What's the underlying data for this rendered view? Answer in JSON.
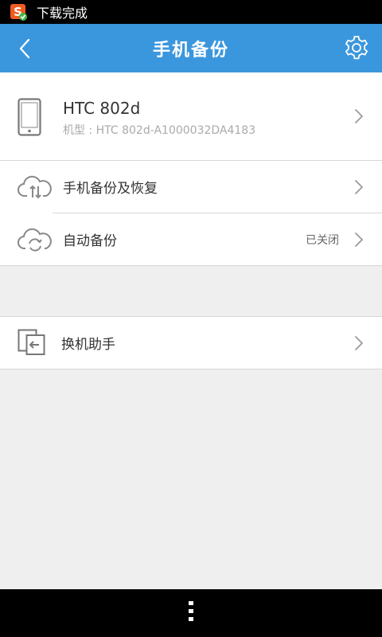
{
  "status_bar": {
    "notification": "下载完成",
    "app_icon": "sougou-s-icon",
    "check_icon": "check-badge-icon"
  },
  "header": {
    "title": "手机备份",
    "back_icon": "chevron-left-icon",
    "settings_icon": "gear-icon",
    "bg_color": "#3b97dd"
  },
  "device": {
    "name": "HTC 802d",
    "model": "机型 : HTC 802d-A1000032DA4183",
    "icon": "phone-icon"
  },
  "menu": {
    "backup_restore": {
      "label": "手机备份及恢复",
      "icon": "cloud-sync-icon"
    },
    "auto_backup": {
      "label": "自动备份",
      "status": "已关闭",
      "icon": "cloud-refresh-icon"
    }
  },
  "switch_assistant": {
    "label": "换机助手",
    "icon": "phone-transfer-icon"
  },
  "nav_bar": {
    "menu_icon": "more-vert-icon"
  }
}
